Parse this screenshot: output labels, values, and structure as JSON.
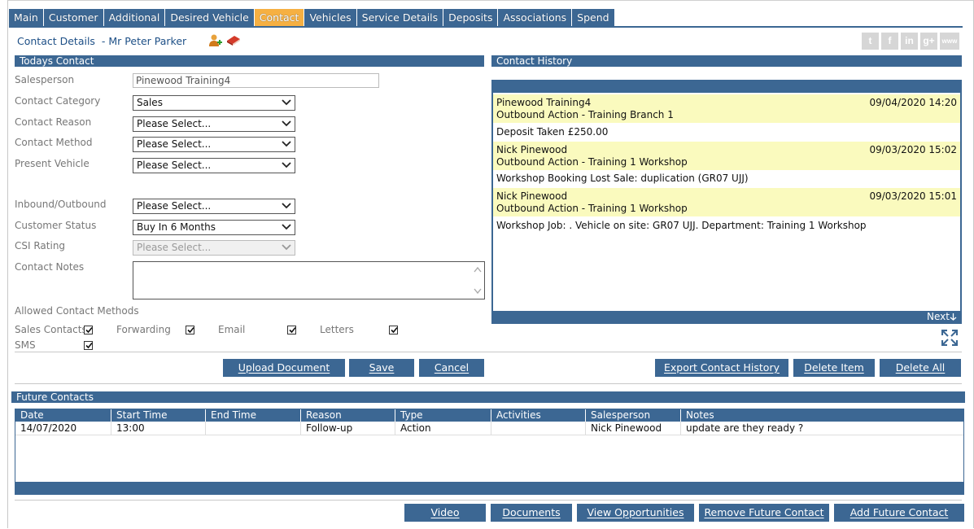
{
  "tabs": [
    "Main",
    "Customer",
    "Additional",
    "Desired Vehicle",
    "Contact",
    "Vehicles",
    "Service Details",
    "Deposits",
    "Associations",
    "Spend"
  ],
  "active_tab": "Contact",
  "header": {
    "contact_details": "Contact Details",
    "customer_name": "- Mr Peter Parker"
  },
  "social": [
    "t",
    "f",
    "in",
    "g+",
    "www"
  ],
  "todays_contact": {
    "title": "Todays Contact",
    "salesperson_label": "Salesperson",
    "salesperson_value": "Pinewood Training4",
    "category_label": "Contact Category",
    "category_value": "Sales",
    "reason_label": "Contact Reason",
    "reason_value": "Please Select...",
    "method_label": "Contact Method",
    "method_value": "Please Select...",
    "vehicle_label": "Present Vehicle",
    "vehicle_value": "Please Select...",
    "inout_label": "Inbound/Outbound",
    "inout_value": "Please Select...",
    "status_label": "Customer Status",
    "status_value": "Buy In 6 Months",
    "csi_label": "CSI Rating",
    "csi_value": "Please Select...",
    "notes_label": "Contact Notes",
    "notes_value": "",
    "allowed_label": "Allowed Contact Methods",
    "methods": [
      {
        "label": "Sales Contacts",
        "checked": true
      },
      {
        "label": "Forwarding",
        "checked": true
      },
      {
        "label": "Email",
        "checked": true
      },
      {
        "label": "Letters",
        "checked": true
      },
      {
        "label": "SMS",
        "checked": true
      }
    ]
  },
  "history": {
    "title": "Contact History",
    "next_label": "Next",
    "entries": [
      {
        "name": "Pinewood Training4",
        "action": "Outbound Action - Training Branch 1",
        "date": "09/04/2020 14:20",
        "body": "Deposit Taken £250.00"
      },
      {
        "name": "Nick Pinewood",
        "action": "Outbound Action - Training 1 Workshop",
        "date": "09/03/2020 15:02",
        "body": "Workshop Booking Lost Sale: duplication (GR07 UJJ)"
      },
      {
        "name": "Nick Pinewood",
        "action": "Outbound Action - Training 1 Workshop",
        "date": "09/03/2020 15:01",
        "body": "Workshop Job: . Vehicle on site: GR07 UJJ. Department: Training 1 Workshop"
      }
    ]
  },
  "buttons": {
    "upload": "Upload Document",
    "save": "Save",
    "cancel": "Cancel",
    "export": "Export Contact History",
    "delete_item": "Delete Item",
    "delete_all": "Delete All",
    "video": "Video",
    "documents": "Documents",
    "view_opps": "View Opportunities",
    "remove_future": "Remove Future Contact",
    "add_future": "Add Future Contact"
  },
  "future": {
    "title": "Future Contacts",
    "columns": [
      "Date",
      "Start Time",
      "End Time",
      "Reason",
      "Type",
      "Activities",
      "Salesperson",
      "Notes"
    ],
    "rows": [
      [
        "14/07/2020",
        "13:00",
        "",
        "Follow-up",
        "Action",
        "",
        "Nick Pinewood",
        "update are they ready ?"
      ]
    ]
  },
  "colors": {
    "accent": "#3c6793",
    "active_tab": "#f6b042",
    "history_highlight": "#fafabe"
  }
}
